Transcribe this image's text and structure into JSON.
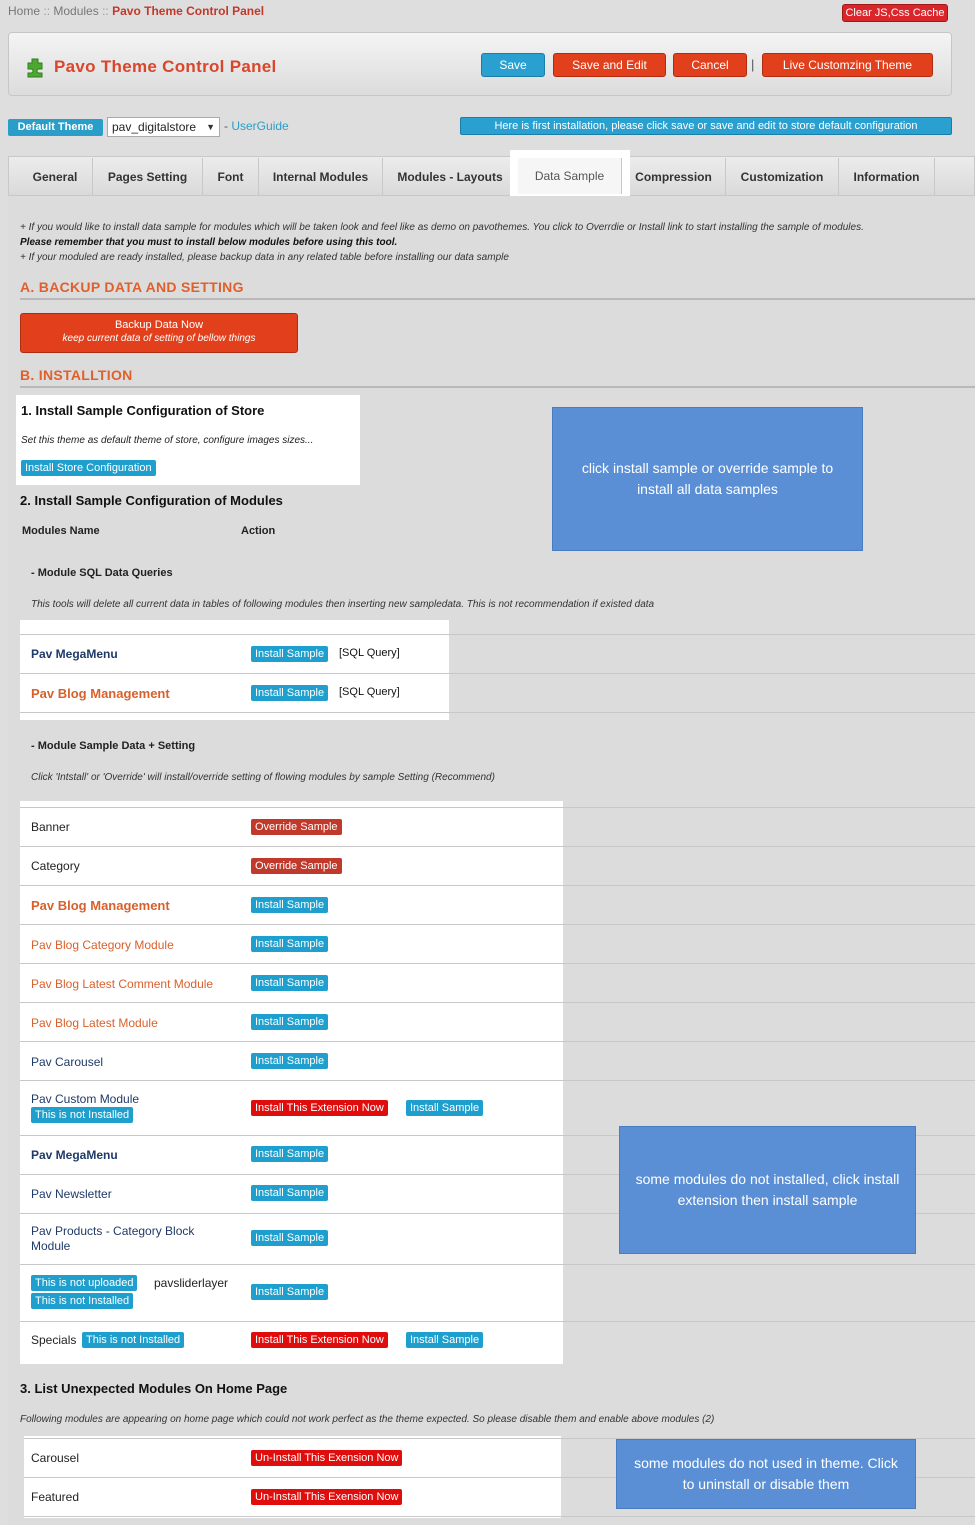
{
  "breadcrumb": {
    "home": "Home",
    "modules": "Modules",
    "current": "Pavo Theme Control Panel",
    "separator": "::"
  },
  "clear_cache_label": "Clear JS,Css Cache",
  "header": {
    "title": "Pavo Theme Control Panel",
    "save": "Save",
    "save_edit": "Save and Edit",
    "cancel": "Cancel",
    "separator": "|",
    "live": "Live Customzing Theme"
  },
  "theme_bar": {
    "label": "Default Theme",
    "selected": "pav_digitalstore",
    "dash": "-",
    "guide": "UserGuide",
    "notice": "Here is first installation, please click save or save and edit to store default configuration"
  },
  "tabs": [
    "General",
    "Pages Setting",
    "Font",
    "Internal Modules",
    "Modules - Layouts",
    "Data Sample",
    "Compression",
    "Customization",
    "Information"
  ],
  "intro": {
    "line1": "+ If you would like to install data sample for modules which will be taken look and feel like as demo on pavothemes. You click to Overrdie or Install link to start installing the sample of modules.",
    "line2": "Please remember that you must to install below modules before using this tool.",
    "line3": "+ If your moduled are ready installed, please backup data in any related table before installing our data sample"
  },
  "section_a": {
    "title": "A. BACKUP DATA AND SETTING",
    "backup_label": "Backup Data Now",
    "backup_sub": "keep current data of setting of bellow things"
  },
  "section_b": {
    "title": "B. INSTALLTION",
    "store_title": "1. Install Sample Configuration of Store",
    "store_desc": "Set this theme as default theme of store, configure images sizes...",
    "store_button": "Install Store Configuration",
    "modules_title": "2. Install Sample Configuration of Modules",
    "col_name": "Modules Name",
    "col_action": "Action",
    "sql_title": "- Module SQL Data Queries",
    "sql_desc": "This tools will delete all current data in tables of following modules then inserting new sampledata. This is not recommendation if existed data",
    "sql_rows": [
      {
        "name": "Pav MegaMenu",
        "button": "Install Sample",
        "note": "[SQL Query]"
      },
      {
        "name": "Pav Blog Management",
        "button": "Install Sample",
        "note": "[SQL Query]"
      }
    ],
    "setting_title": "- Module Sample Data + Setting",
    "setting_desc": "Click 'Intstall' or 'Override' will install/override setting of flowing modules by sample Setting (Recommend)",
    "setting_rows": {
      "banner": {
        "name": "Banner",
        "btn": "Override Sample"
      },
      "category": {
        "name": "Category",
        "btn": "Override Sample"
      },
      "blog_mgmt": {
        "name": "Pav Blog Management",
        "btn": "Install Sample"
      },
      "blog_cat": {
        "name": "Pav Blog Category Module",
        "btn": "Install Sample"
      },
      "blog_comment": {
        "name": "Pav Blog Latest Comment Module",
        "btn": "Install Sample"
      },
      "blog_latest": {
        "name": "Pav Blog Latest Module",
        "btn": "Install Sample"
      },
      "carousel": {
        "name": "Pav Carousel",
        "btn": "Install Sample"
      },
      "custom": {
        "name": "Pav Custom Module",
        "badge": "This is not Installed",
        "btn_ext": "Install This Extension Now",
        "btn": "Install Sample"
      },
      "megamenu": {
        "name": "Pav MegaMenu",
        "btn": "Install Sample"
      },
      "newsletter": {
        "name": "Pav Newsletter",
        "btn": "Install Sample"
      },
      "products": {
        "name1": "Pav Products - Category Block",
        "name2": "Module",
        "btn": "Install Sample"
      },
      "slider": {
        "badge1": "This is not uploaded",
        "name": "pavsliderlayer",
        "badge2": "This is not Installed",
        "btn": "Install Sample"
      },
      "specials": {
        "name": "Specials",
        "badge": "This is not Installed",
        "btn_ext": "Install This Extension Now",
        "btn": "Install Sample"
      }
    }
  },
  "section_3": {
    "title": "3. List Unexpected Modules On Home Page",
    "desc": "Following modules are appearing on home page which could not work perfect as the theme expected. So please disable them and enable above modules (2)",
    "rows": [
      {
        "name": "Carousel",
        "btn": "Un-Install This Exension Now"
      },
      {
        "name": "Featured",
        "btn": "Un-Install This Exension Now"
      }
    ]
  },
  "callouts": {
    "c1": "click install sample or override sample to install all data samples",
    "c2": "some modules do not installed, click install extension then install sample",
    "c3": "some modules do not used in theme. Click to uninstall or disable them"
  },
  "colors": {
    "accent_orange": "#e0602b",
    "button_blue": "#1e9fce",
    "button_red": "#e00d0d",
    "callout_blue": "#5a8fd6"
  }
}
